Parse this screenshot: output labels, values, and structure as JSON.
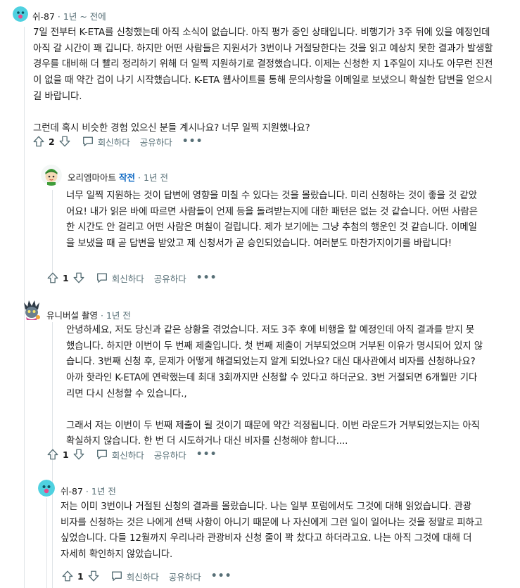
{
  "comments": [
    {
      "user": "쉬-87",
      "time": "1년 ~ 전에",
      "paragraphs": [
        "7일 전부터 K-ETA를 신청했는데 아직 소식이 없습니다. 아직 평가 중인 상태입니다. 비행기가 3주 뒤에 있을 예정인데 아직 갈 시간이 꽤 깁니다. 하지만 어떤 사람들은 지원서가 3번이나 거절당한다는 것을 읽고 예상치 못한 결과가 발생할 경우를 대비해 더 빨리 정리하기 위해 더 일찍 지원하기로 결정했습니다. 이제는 신청한 지 1주일이 지나도 아무런 진전이 없을 때 약간 겁이 나기 시작했습니다. K-ETA 웹사이트를 통해 문의사항을 이메일로 보냈으니 확실한 답변을 얻으시길 바랍니다.",
        "그런데 혹시 비슷한 경험 있으신 분들 계시나요? 너무 일찍 지원했나요?"
      ],
      "votes": "2",
      "reply": "회신하다",
      "share": "공유하다",
      "more": "•••"
    },
    {
      "user": "오리엠마아트",
      "op": "작전",
      "time": "1년 전",
      "paragraphs": [
        "너무 일찍 지원하는 것이 답변에 영향을 미칠 수 있다는 것을 몰랐습니다. 미리 신청하는 것이 좋을 것 같았어요! 내가 읽은 바에 따르면 사람들이 언제 등을 돌려받는지에 대한 패턴은 없는 것 같습니다. 어떤 사람은 한 시간도 안 걸리고 어떤 사람은 며칠이 걸립니다. 제가 보기에는 그냥 추첨의 행운인 것 같습니다. 이메일을 보냈을 때 곧 답변을 받았고 제 신청서가 곧 승인되었습니다. 여러분도 마찬가지이기를 바랍니다!"
      ],
      "votes": "1",
      "reply": "회신하다",
      "share": "공유하다",
      "more": "•••"
    },
    {
      "user": "유니버설 촬영",
      "time": "1년 전",
      "paragraphs": [
        "안녕하세요, 저도 당신과 같은 상황을 겪었습니다. 저도 3주 후에 비행을 할 예정인데 아직 결과를 받지 못했습니다. 하지만 이번이 두 번째 제출입니다. 첫 번째 제출이 거부되었으며 거부된 이유가 명시되어 있지 않습니다. 3번째 신청 후, 문제가 어떻게 해결되었는지 알게 되었나요? 대신 대사관에서 비자를 신청하나요? 아까 핫라인 K-ETA에 연락했는데 최대 3회까지만 신청할 수 있다고 하더군요. 3번 거절되면 6개월만 기다리면 다시 신청할 수 있습니다.,",
        "그래서 저는 이번이 두 번째 제출이 될 것이기 때문에 약간 걱정됩니다. 이번 라운드가 거부되었는지는 아직 확실하지 않습니다. 한 번 더 시도하거나 대신 비자를 신청해야 합니다...."
      ],
      "votes": "1",
      "reply": "회신하다",
      "share": "공유하다",
      "more": "•••"
    },
    {
      "user": "쉬-87",
      "time": "1년 전",
      "paragraphs": [
        "저는 이미 3번이나 거절된 신청의 결과를 몰랐습니다. 나는 일부 포럼에서도 그것에 대해 읽었습니다. 관광 비자를 신청하는 것은 나에게 선택 사항이 아니기 때문에 나 자신에게 그런 일이 일어나는 것을 정말로 피하고 싶었습니다. 다들 12월까지 우리나라 관광비자 신청 줄이 꽉 찼다고 하더라고요. 나는 아직 그것에 대해 더 자세히 확인하지 않았습니다."
      ],
      "votes": "1",
      "reply": "회신하다",
      "share": "공유하다",
      "more": "•••"
    }
  ],
  "colors": {
    "text": "#1c1c1c",
    "meta": "#576f76",
    "op_badge": "#0a66c2",
    "thread_line": "#e0e4e7",
    "avatar_teal": "#4fd1e0"
  },
  "icons": [
    "upvote-icon",
    "downvote-icon",
    "comment-icon",
    "overflow-icon"
  ]
}
